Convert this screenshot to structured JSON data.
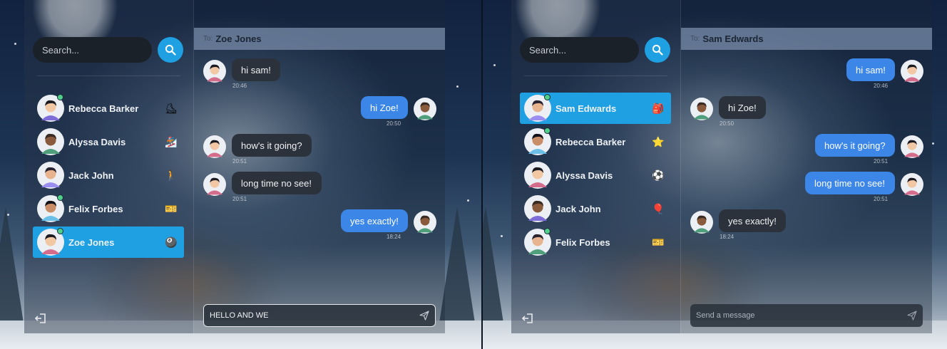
{
  "left": {
    "search": {
      "placeholder": "Search..."
    },
    "contacts": [
      {
        "name": "Rebecca Barker",
        "emoji": "⛸",
        "online": true,
        "active": false
      },
      {
        "name": "Alyssa Davis",
        "emoji": "🏂",
        "online": false,
        "active": false
      },
      {
        "name": "Jack John",
        "emoji": "🚶",
        "online": false,
        "active": false
      },
      {
        "name": "Felix Forbes",
        "emoji": "🎫",
        "online": true,
        "active": false
      },
      {
        "name": "Zoe Jones",
        "emoji": "🎱",
        "online": true,
        "active": true
      }
    ],
    "chat": {
      "to_label": "To:",
      "recipient": "Zoe Jones",
      "messages": [
        {
          "dir": "in",
          "text": "hi sam!",
          "time": "20:46"
        },
        {
          "dir": "out",
          "text": "hi Zoe!",
          "time": "20:50"
        },
        {
          "dir": "in",
          "text": "how's it going?",
          "time": "20:51"
        },
        {
          "dir": "in",
          "text": "long time no see!",
          "time": "20:51"
        },
        {
          "dir": "out",
          "text": "yes exactly!",
          "time": "18:24"
        }
      ],
      "composer_value": "HELLO AND WE",
      "composer_placeholder": "Send a message"
    }
  },
  "right": {
    "search": {
      "placeholder": "Search..."
    },
    "contacts": [
      {
        "name": "Sam Edwards",
        "emoji": "🎒",
        "online": true,
        "active": true
      },
      {
        "name": "Rebecca Barker",
        "emoji": "⭐",
        "online": true,
        "active": false
      },
      {
        "name": "Alyssa Davis",
        "emoji": "⚽",
        "online": false,
        "active": false
      },
      {
        "name": "Jack John",
        "emoji": "🎈",
        "online": false,
        "active": false
      },
      {
        "name": "Felix Forbes",
        "emoji": "🎫",
        "online": true,
        "active": false
      }
    ],
    "chat": {
      "to_label": "To:",
      "recipient": "Sam Edwards",
      "messages": [
        {
          "dir": "out",
          "text": "hi sam!",
          "time": "20:46"
        },
        {
          "dir": "in",
          "text": "hi Zoe!",
          "time": "20:50"
        },
        {
          "dir": "out",
          "text": "how's it going?",
          "time": "20:51"
        },
        {
          "dir": "out",
          "text": "long time no see!",
          "time": "20:51"
        },
        {
          "dir": "in",
          "text": "yes exactly!",
          "time": "18:24"
        }
      ],
      "composer_value": "",
      "composer_placeholder": "Send a message"
    }
  },
  "icons": {
    "search": "search-icon",
    "send": "send-icon",
    "logout": "logout-icon"
  },
  "colors": {
    "accent": "#1ea0e3",
    "outgoing_bubble": "#3c86e8",
    "incoming_bubble": "#2c323b",
    "online": "#4fd08a"
  }
}
